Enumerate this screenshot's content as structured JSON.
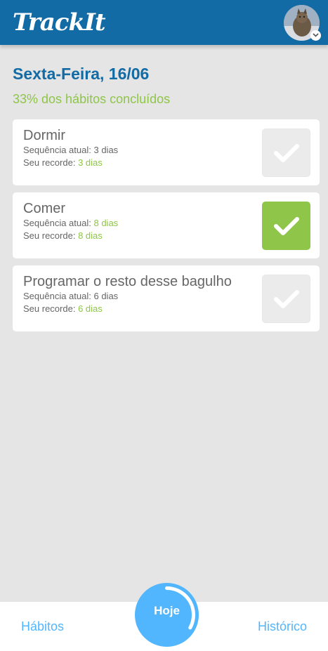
{
  "app": {
    "title": "TrackIt"
  },
  "header": {
    "avatar_icon": "user-avatar-cat",
    "badge_icon": "chevron-down-icon"
  },
  "today": {
    "date": "Sexta-Feira, 16/06",
    "progress_text": "33% dos hábitos concluídos",
    "progress_fraction": 0.33
  },
  "habits": [
    {
      "name": "Dormir",
      "streak_label": "Sequência atual:",
      "streak": "3 dias",
      "record_label": "Seu recorde:",
      "record": "3 dias",
      "done": false
    },
    {
      "name": "Comer",
      "streak_label": "Sequência atual:",
      "streak": "8 dias",
      "record_label": "Seu recorde:",
      "record": "8 dias",
      "done": true
    },
    {
      "name": "Programar o resto desse bagulho",
      "streak_label": "Sequência atual:",
      "streak": "6 dias",
      "record_label": "Seu recorde:",
      "record": "6 dias",
      "done": false
    }
  ],
  "footer": {
    "habits_label": "Hábitos",
    "today_label": "Hoje",
    "history_label": "Histórico"
  },
  "colors": {
    "primary": "#126ba5",
    "accent": "#52b6ff",
    "success": "#8fc549",
    "unchecked": "#ebebeb"
  }
}
